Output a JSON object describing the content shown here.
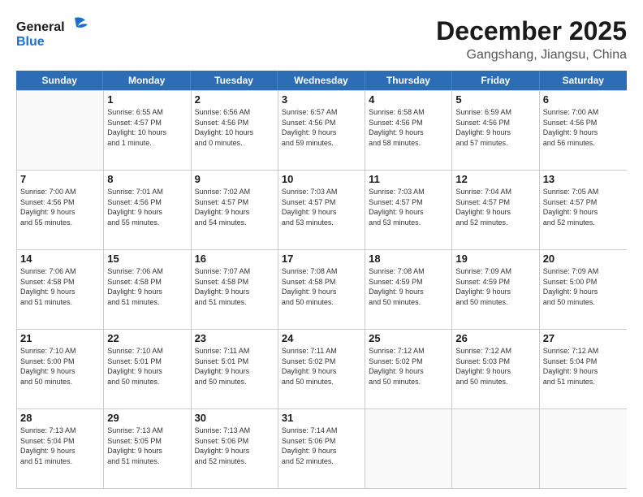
{
  "header": {
    "logo_general": "General",
    "logo_blue": "Blue",
    "month_title": "December 2025",
    "location": "Gangshang, Jiangsu, China"
  },
  "weekdays": [
    "Sunday",
    "Monday",
    "Tuesday",
    "Wednesday",
    "Thursday",
    "Friday",
    "Saturday"
  ],
  "weeks": [
    [
      {
        "day": "",
        "info": ""
      },
      {
        "day": "1",
        "info": "Sunrise: 6:55 AM\nSunset: 4:57 PM\nDaylight: 10 hours\nand 1 minute."
      },
      {
        "day": "2",
        "info": "Sunrise: 6:56 AM\nSunset: 4:56 PM\nDaylight: 10 hours\nand 0 minutes."
      },
      {
        "day": "3",
        "info": "Sunrise: 6:57 AM\nSunset: 4:56 PM\nDaylight: 9 hours\nand 59 minutes."
      },
      {
        "day": "4",
        "info": "Sunrise: 6:58 AM\nSunset: 4:56 PM\nDaylight: 9 hours\nand 58 minutes."
      },
      {
        "day": "5",
        "info": "Sunrise: 6:59 AM\nSunset: 4:56 PM\nDaylight: 9 hours\nand 57 minutes."
      },
      {
        "day": "6",
        "info": "Sunrise: 7:00 AM\nSunset: 4:56 PM\nDaylight: 9 hours\nand 56 minutes."
      }
    ],
    [
      {
        "day": "7",
        "info": "Sunrise: 7:00 AM\nSunset: 4:56 PM\nDaylight: 9 hours\nand 55 minutes."
      },
      {
        "day": "8",
        "info": "Sunrise: 7:01 AM\nSunset: 4:56 PM\nDaylight: 9 hours\nand 55 minutes."
      },
      {
        "day": "9",
        "info": "Sunrise: 7:02 AM\nSunset: 4:57 PM\nDaylight: 9 hours\nand 54 minutes."
      },
      {
        "day": "10",
        "info": "Sunrise: 7:03 AM\nSunset: 4:57 PM\nDaylight: 9 hours\nand 53 minutes."
      },
      {
        "day": "11",
        "info": "Sunrise: 7:03 AM\nSunset: 4:57 PM\nDaylight: 9 hours\nand 53 minutes."
      },
      {
        "day": "12",
        "info": "Sunrise: 7:04 AM\nSunset: 4:57 PM\nDaylight: 9 hours\nand 52 minutes."
      },
      {
        "day": "13",
        "info": "Sunrise: 7:05 AM\nSunset: 4:57 PM\nDaylight: 9 hours\nand 52 minutes."
      }
    ],
    [
      {
        "day": "14",
        "info": "Sunrise: 7:06 AM\nSunset: 4:58 PM\nDaylight: 9 hours\nand 51 minutes."
      },
      {
        "day": "15",
        "info": "Sunrise: 7:06 AM\nSunset: 4:58 PM\nDaylight: 9 hours\nand 51 minutes."
      },
      {
        "day": "16",
        "info": "Sunrise: 7:07 AM\nSunset: 4:58 PM\nDaylight: 9 hours\nand 51 minutes."
      },
      {
        "day": "17",
        "info": "Sunrise: 7:08 AM\nSunset: 4:58 PM\nDaylight: 9 hours\nand 50 minutes."
      },
      {
        "day": "18",
        "info": "Sunrise: 7:08 AM\nSunset: 4:59 PM\nDaylight: 9 hours\nand 50 minutes."
      },
      {
        "day": "19",
        "info": "Sunrise: 7:09 AM\nSunset: 4:59 PM\nDaylight: 9 hours\nand 50 minutes."
      },
      {
        "day": "20",
        "info": "Sunrise: 7:09 AM\nSunset: 5:00 PM\nDaylight: 9 hours\nand 50 minutes."
      }
    ],
    [
      {
        "day": "21",
        "info": "Sunrise: 7:10 AM\nSunset: 5:00 PM\nDaylight: 9 hours\nand 50 minutes."
      },
      {
        "day": "22",
        "info": "Sunrise: 7:10 AM\nSunset: 5:01 PM\nDaylight: 9 hours\nand 50 minutes."
      },
      {
        "day": "23",
        "info": "Sunrise: 7:11 AM\nSunset: 5:01 PM\nDaylight: 9 hours\nand 50 minutes."
      },
      {
        "day": "24",
        "info": "Sunrise: 7:11 AM\nSunset: 5:02 PM\nDaylight: 9 hours\nand 50 minutes."
      },
      {
        "day": "25",
        "info": "Sunrise: 7:12 AM\nSunset: 5:02 PM\nDaylight: 9 hours\nand 50 minutes."
      },
      {
        "day": "26",
        "info": "Sunrise: 7:12 AM\nSunset: 5:03 PM\nDaylight: 9 hours\nand 50 minutes."
      },
      {
        "day": "27",
        "info": "Sunrise: 7:12 AM\nSunset: 5:04 PM\nDaylight: 9 hours\nand 51 minutes."
      }
    ],
    [
      {
        "day": "28",
        "info": "Sunrise: 7:13 AM\nSunset: 5:04 PM\nDaylight: 9 hours\nand 51 minutes."
      },
      {
        "day": "29",
        "info": "Sunrise: 7:13 AM\nSunset: 5:05 PM\nDaylight: 9 hours\nand 51 minutes."
      },
      {
        "day": "30",
        "info": "Sunrise: 7:13 AM\nSunset: 5:06 PM\nDaylight: 9 hours\nand 52 minutes."
      },
      {
        "day": "31",
        "info": "Sunrise: 7:14 AM\nSunset: 5:06 PM\nDaylight: 9 hours\nand 52 minutes."
      },
      {
        "day": "",
        "info": ""
      },
      {
        "day": "",
        "info": ""
      },
      {
        "day": "",
        "info": ""
      }
    ]
  ]
}
